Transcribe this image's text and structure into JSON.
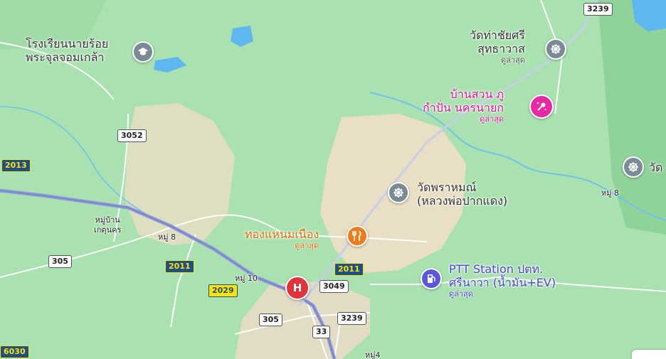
{
  "colors": {
    "land": "#a9e2b0",
    "forest": "#8fd39a",
    "built": "#f2e2c8",
    "water": "#5fb7ef",
    "highway": "#8f9ad8",
    "road": "#ffffff",
    "temple_pin": "#7a8b95",
    "school_pin": "#7a8b95",
    "restaurant_pin": "#ef7c1a",
    "hospital_pin": "#e1333b",
    "fuel_pin": "#5b57d9",
    "attraction_pin": "#e62aa5",
    "orange_text": "#e06a00",
    "magenta_text": "#e0159a",
    "blue_text": "#4d45c9"
  },
  "pois": {
    "school": {
      "line1": "โรงเรียนนายร้อย",
      "line2": "พระจุลจอมเกล้า",
      "icon": "graduation-cap-icon"
    },
    "wat_tha_chai": {
      "line1": "วัดท่าชัยศรี",
      "line2": "สุทธาวาส",
      "sub": "ดูล่าสุด",
      "icon": "dharma-wheel-icon"
    },
    "baan_suan": {
      "line1": "บ้านสวน ภู",
      "line2": "กำปั่น นครนายก",
      "sub": "ดูล่าสุด",
      "icon": "spa-icon"
    },
    "wat_right": {
      "line1": "วัด",
      "icon": "dharma-wheel-icon"
    },
    "wat_phram": {
      "line1": "วัดพราหมณ์",
      "line2": "(หลวงพ่อปากแดง)",
      "icon": "dharma-wheel-icon"
    },
    "thong_haem": {
      "line1": "ทองแหนมเนือง",
      "sub": "ดูล่าสุด",
      "icon": "fork-knife-icon"
    },
    "hospital": {
      "letter": "H",
      "icon": "hospital-icon"
    },
    "ptt": {
      "line1": "PTT Station ปตท.",
      "line2": "ศรีนาวา (น้ำมัน+EV)",
      "sub": "ดูล่าสุด",
      "icon": "fuel-pump-icon"
    }
  },
  "villages": {
    "baan_ket": {
      "line1": "หมู่บ้าน",
      "line2": "เกตุนคร"
    },
    "moo8_left": "หมู่ 8",
    "moo8_right": "หมู่ 8",
    "moo10": "หมู่ 10",
    "moo4": "หมู่4"
  },
  "route_shields": [
    {
      "num": "3239",
      "style": "white"
    },
    {
      "num": "3052",
      "style": "white"
    },
    {
      "num": "2013",
      "style": "blue"
    },
    {
      "num": "305",
      "style": "white"
    },
    {
      "num": "2011",
      "style": "blue"
    },
    {
      "num": "2029",
      "style": "yellow"
    },
    {
      "num": "2011",
      "style": "blue"
    },
    {
      "num": "3049",
      "style": "white"
    },
    {
      "num": "305",
      "style": "white"
    },
    {
      "num": "3239",
      "style": "white"
    },
    {
      "num": "33",
      "style": "white"
    },
    {
      "num": "6030",
      "style": "blue"
    }
  ]
}
